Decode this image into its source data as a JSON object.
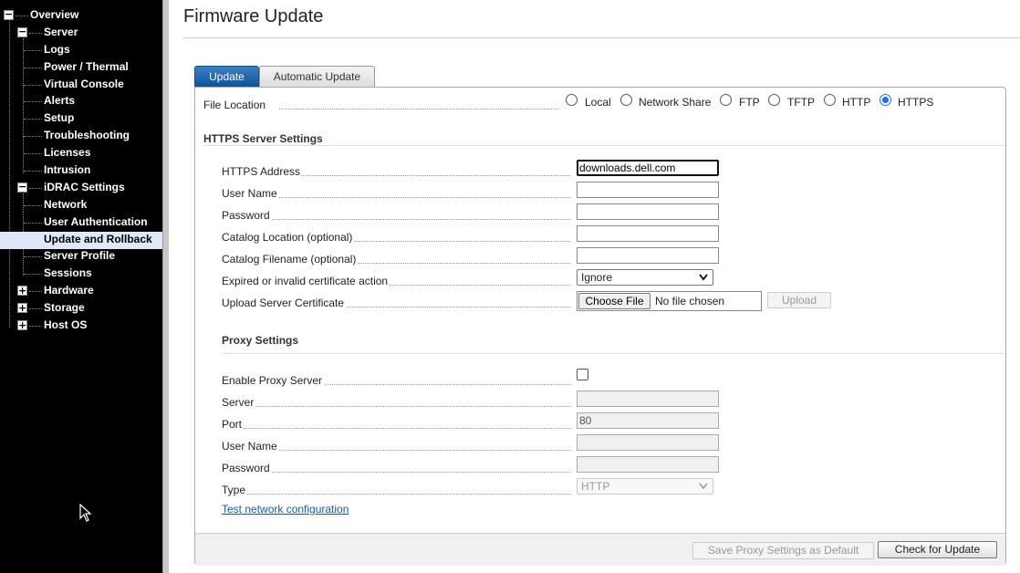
{
  "sidebar": {
    "items": [
      {
        "label": "Overview"
      },
      {
        "label": "Server"
      },
      {
        "label": "Logs"
      },
      {
        "label": "Power / Thermal"
      },
      {
        "label": "Virtual Console"
      },
      {
        "label": "Alerts"
      },
      {
        "label": "Setup"
      },
      {
        "label": "Troubleshooting"
      },
      {
        "label": "Licenses"
      },
      {
        "label": "Intrusion"
      },
      {
        "label": "iDRAC Settings"
      },
      {
        "label": "Network"
      },
      {
        "label": "User Authentication"
      },
      {
        "label": "Update and Rollback"
      },
      {
        "label": "Server Profile"
      },
      {
        "label": "Sessions"
      },
      {
        "label": "Hardware"
      },
      {
        "label": "Storage"
      },
      {
        "label": "Host OS"
      }
    ],
    "selected": "Update and Rollback",
    "expand_glyph": "+",
    "collapse_glyph": "−"
  },
  "page": {
    "title": "Firmware Update",
    "tabs": [
      {
        "label": "Update",
        "active": true
      },
      {
        "label": "Automatic Update",
        "active": false
      }
    ]
  },
  "file_location": {
    "label": "File Location",
    "options": [
      "Local",
      "Network Share",
      "FTP",
      "TFTP",
      "HTTP",
      "HTTPS"
    ],
    "selected": "HTTPS"
  },
  "https_settings": {
    "heading": "HTTPS Server Settings",
    "address_label": "HTTPS Address",
    "address_value": "downloads.dell.com",
    "username_label": "User Name",
    "password_label": "Password",
    "catalog_location_label": "Catalog Location (optional)",
    "catalog_filename_label": "Catalog Filename (optional)",
    "cert_action_label": "Expired or invalid certificate action",
    "cert_action_value": "Ignore",
    "upload_cert_label": "Upload Server Certificate",
    "choose_file_label": "Choose File",
    "no_file_text": "No file chosen",
    "upload_label": "Upload"
  },
  "proxy": {
    "heading": "Proxy Settings",
    "enable_label": "Enable Proxy Server",
    "server_label": "Server",
    "port_label": "Port",
    "port_value": "80",
    "username_label": "User Name",
    "password_label": "Password",
    "type_label": "Type",
    "type_value": "HTTP",
    "test_link": "Test network configuration"
  },
  "footer": {
    "save_proxy_label": "Save Proxy Settings as Default",
    "check_update_label": "Check for Update"
  },
  "colors": {
    "sidebar_bg": "#000000",
    "tab_active": "#0b5299",
    "selected_row": "#dfe8f6",
    "link": "#1a56b3",
    "radio_accent": "#1a73e8"
  },
  "icons": {
    "tree_expand": "plus-box-icon",
    "tree_collapse": "minus-box-icon",
    "dropdown": "chevron-down-icon",
    "cursor": "mouse-pointer-icon"
  }
}
